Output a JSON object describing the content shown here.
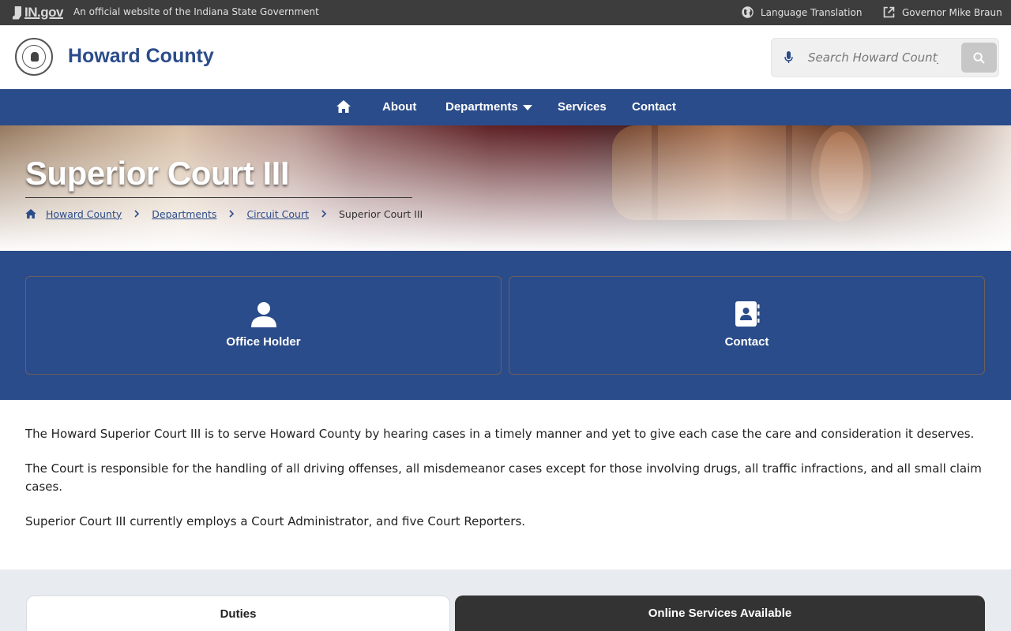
{
  "statebar": {
    "logo_text": "IN.gov",
    "official_text": "An official website of the Indiana State Government",
    "language_link": "Language Translation",
    "governor_link": "Governor Mike Braun"
  },
  "header": {
    "site_name": "Howard County",
    "search_placeholder": "Search Howard County"
  },
  "nav": {
    "items": [
      "About",
      "Departments",
      "Services",
      "Contact"
    ]
  },
  "hero": {
    "title": "Superior Court III",
    "breadcrumbs": [
      "Howard County",
      "Departments",
      "Circuit Court",
      "Superior Court III"
    ]
  },
  "quick_links": [
    {
      "label": "Office Holder",
      "icon": "person-icon"
    },
    {
      "label": "Contact",
      "icon": "address-book-icon"
    }
  ],
  "content": {
    "paragraphs": [
      "The Howard Superior Court III is to serve Howard County by hearing cases in a timely manner and yet to give each case the care and consideration it deserves.",
      "The Court is responsible for the handling of all driving offenses, all misdemeanor cases except for those involving drugs, all traffic infractions, and all small claim cases.",
      "Superior Court III currently employs a Court Administrator, and five Court Reporters."
    ]
  },
  "tabs": [
    "Duties",
    "Online Services Available"
  ],
  "colors": {
    "brand_blue": "#2b4c8a",
    "state_bar": "#3d3d3d",
    "dark_tab": "#333333"
  }
}
